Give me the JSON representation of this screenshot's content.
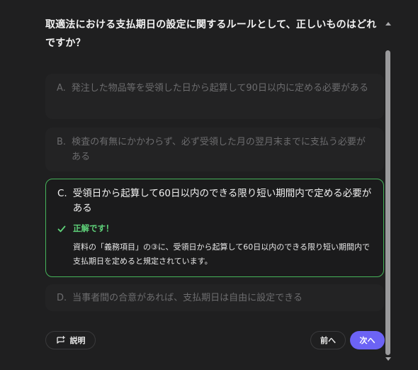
{
  "question": "取適法における支払期日の設定に関するルールとして、正しいものはどれですか？",
  "options": [
    {
      "letter": "A.",
      "text": "発注した物品等を受領した日から起算して90日以内に定める必要がある"
    },
    {
      "letter": "B.",
      "text": "検査の有無にかかわらず、必ず受領した月の翌月末までに支払う必要がある"
    },
    {
      "letter": "C.",
      "text": "受領日から起算して60日以内のできる限り短い期間内で定める必要がある"
    },
    {
      "letter": "D.",
      "text": "当事者間の合意があれば、支払期日は自由に設定できる"
    }
  ],
  "feedback": {
    "title": "正解です！",
    "body": "資料の「義務項目」の③に、受領日から起算して60日以内のできる限り短い期間内で支払期日を定めると規定されています。"
  },
  "buttons": {
    "explain": "説明",
    "prev": "前へ",
    "next": "次へ"
  },
  "icons": {
    "check": "check-icon",
    "explain": "comment-plus-icon"
  },
  "colors": {
    "correct": "#46b45a",
    "primary": "#6c63f5",
    "background": "#1f1f20"
  }
}
